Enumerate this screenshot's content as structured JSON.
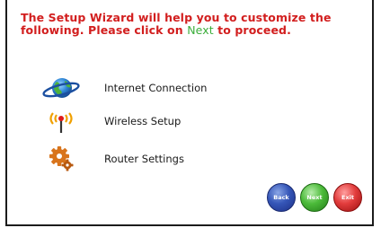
{
  "intro": {
    "line1": "The Setup Wizard will help you to customize the",
    "line2_before": "following. Please click on ",
    "line2_highlight": "Next",
    "line2_after": " to proceed."
  },
  "items": [
    {
      "label": "Internet Connection",
      "icon": "globe-icon"
    },
    {
      "label": "Wireless Setup",
      "icon": "wireless-antenna-icon"
    },
    {
      "label": "Router Settings",
      "icon": "gear-icon"
    }
  ],
  "buttons": {
    "back": "Back",
    "next": "Next",
    "exit": "Exit"
  },
  "colors": {
    "heading": "#d21e1e",
    "highlight": "#3cae3c",
    "back": "#3556b8",
    "next": "#4cbb3a",
    "exit": "#e23c3c"
  }
}
